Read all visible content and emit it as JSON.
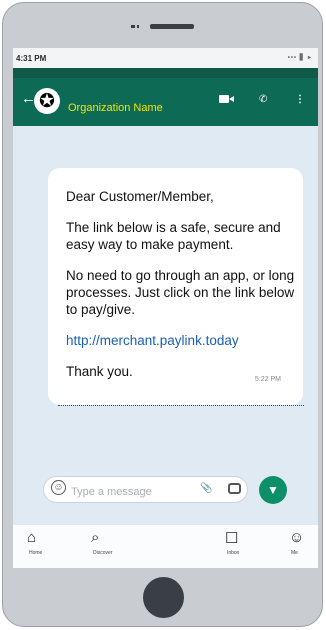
{
  "statusbar": {
    "time": "4:31 PM",
    "sys_icons": "••• ▋ ▸"
  },
  "chat_header": {
    "back_glyph": "←",
    "avatar_glyph": "✪",
    "name": "Organization Name"
  },
  "message": {
    "greeting": "Dear Customer/Member,",
    "line1": "The link below is a safe, secure and easy way to make payment.",
    "line2": "No need to go through an app, or long processes. Just click on the link below to pay/give.",
    "link": "http://merchant.paylink.today",
    "closing": "Thank you.",
    "time": "5:22 PM"
  },
  "composer": {
    "placeholder": "Type a message",
    "emoji_icon": "emoji-icon",
    "attach_icon": "paperclip-icon",
    "camera_icon": "camera-icon",
    "send_icon": "microphone-icon"
  },
  "bottom_nav": [
    {
      "label": "Home",
      "icon": "home-icon",
      "glyph": "⌂"
    },
    {
      "label": "Discover",
      "icon": "search-icon",
      "glyph": "⌕"
    },
    {
      "label": "Inbox",
      "icon": "inbox-icon",
      "glyph": "☐"
    },
    {
      "label": "Me",
      "icon": "person-icon",
      "glyph": "☺"
    }
  ],
  "colors": {
    "header": "#0d6b55",
    "header_dark": "#0e5a47",
    "org_name": "#f5e400",
    "link": "#1a5fb4",
    "send": "#0d8f6a",
    "chat_bg": "#dfeaf2"
  }
}
